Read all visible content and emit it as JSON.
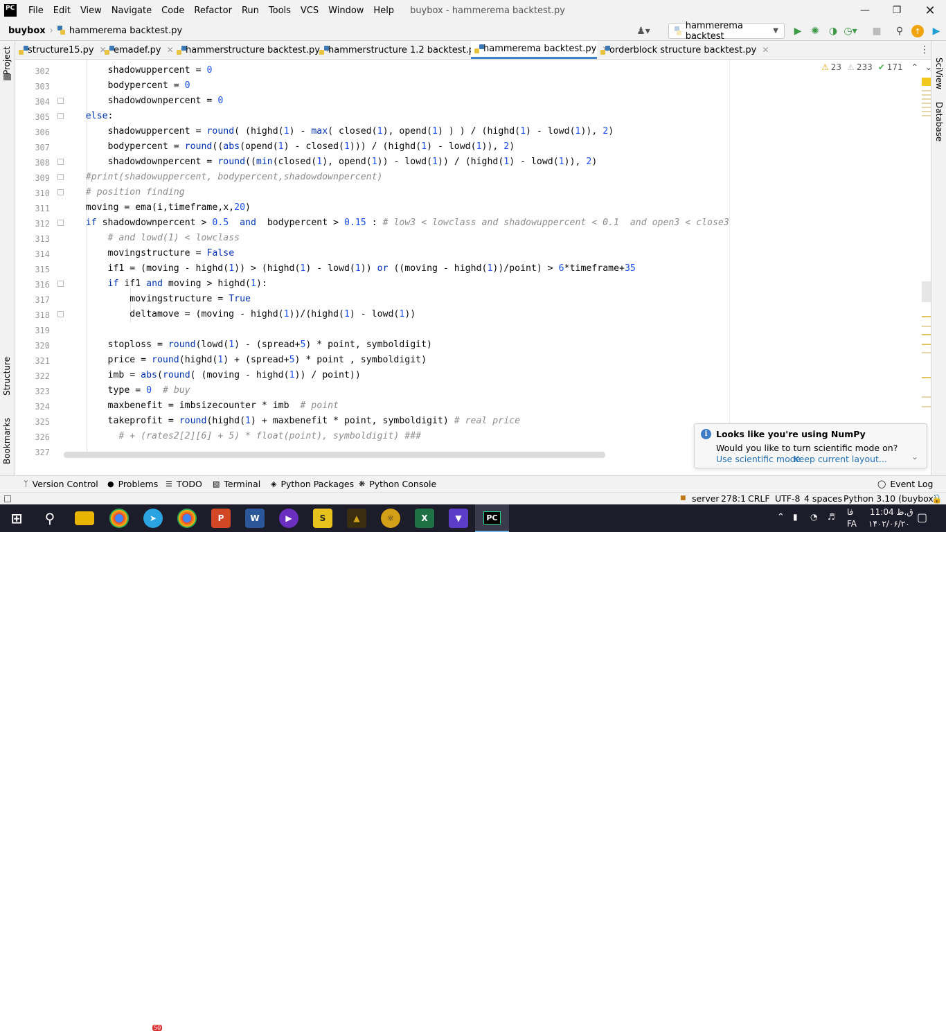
{
  "titlebar": {
    "logo": "PC",
    "menu": [
      "File",
      "Edit",
      "View",
      "Navigate",
      "Code",
      "Refactor",
      "Run",
      "Tools",
      "VCS",
      "Window",
      "Help"
    ],
    "window_title": "buybox - hammerema backtest.py"
  },
  "navbar": {
    "project": "buybox",
    "file": "hammerema backtest.py",
    "run_config": "hammerema backtest"
  },
  "tabs": [
    {
      "label": "structure15.py"
    },
    {
      "label": "emadef.py"
    },
    {
      "label": "hammerstructure backtest.py"
    },
    {
      "label": "hammerstructure 1.2 backtest.py"
    },
    {
      "label": "hammerema backtest.py",
      "active": true
    },
    {
      "label": "orderblock structure backtest.py"
    }
  ],
  "side": {
    "left": [
      "Project",
      "Structure",
      "Bookmarks"
    ],
    "right": [
      "SciView",
      "Database"
    ]
  },
  "inspections": {
    "warnings": "23",
    "weak_warnings": "233",
    "typos": "171"
  },
  "editor": {
    "line_numbers": [
      "302",
      "303",
      "304",
      "305",
      "306",
      "307",
      "308",
      "309",
      "310",
      "311",
      "312",
      "313",
      "314",
      "315",
      "316",
      "317",
      "318",
      "319",
      "320",
      "321",
      "322",
      "323",
      "324",
      "325",
      "326",
      "327"
    ]
  },
  "notification": {
    "title": "Looks like you're using NumPy",
    "body": "Would you like to turn scientific mode on?",
    "action1": "Use scientific mode",
    "action2": "Keep current layout..."
  },
  "bottom_tools": [
    "Version Control",
    "Problems",
    "TODO",
    "Terminal",
    "Python Packages",
    "Python Console"
  ],
  "event_log": "Event Log",
  "status": {
    "server": "server",
    "position": "278:1",
    "line_sep": "CRLF",
    "encoding": "UTF-8",
    "indent": "4 spaces",
    "interpreter": "Python 3.10 (buybox)"
  },
  "taskbar": {
    "time": "11:04 ق.ظ",
    "date": "۱۴۰۲/۰۶/۲۰",
    "lang": "FA",
    "lang_script": "فا",
    "telegram_badge": "50"
  }
}
